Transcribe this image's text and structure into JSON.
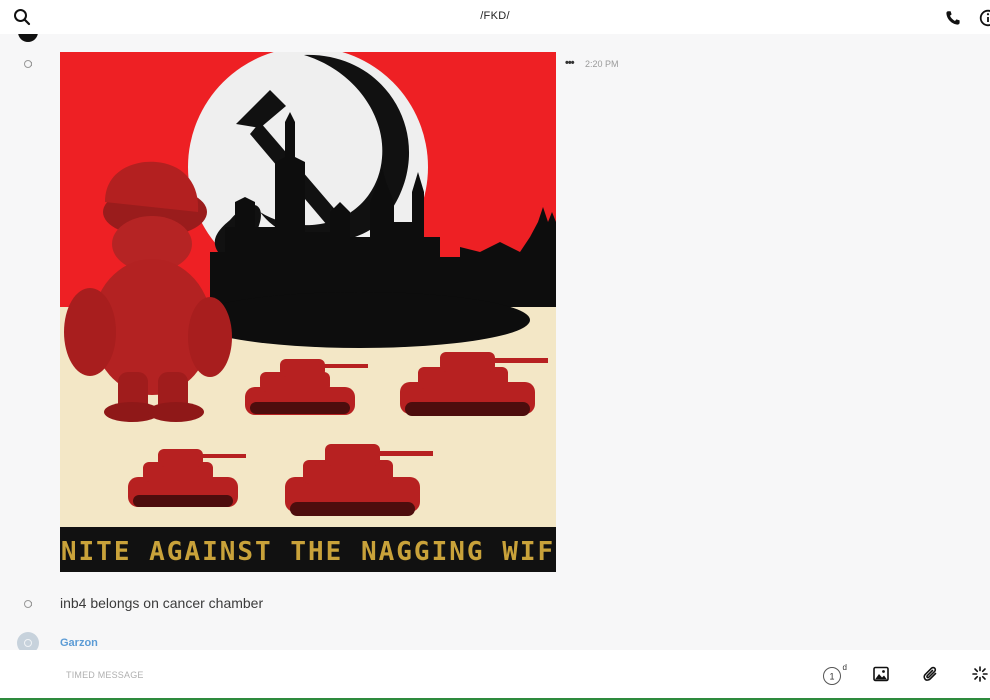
{
  "header": {
    "title": "/FKD/",
    "icons": {
      "search": "search-icon",
      "phone": "phone-icon",
      "info": "info-icon"
    }
  },
  "messages": [
    {
      "type": "image",
      "time": "2:20 PM",
      "poster_caption": "UNITE AGAINST THE NAGGING WIFE"
    },
    {
      "type": "text",
      "text": "inb4 belongs on cancer chamber"
    }
  ],
  "next_sender": {
    "name": "Garzon"
  },
  "composer": {
    "placeholder": "TIMED MESSAGE",
    "timer_value": "1",
    "timer_unit": "d"
  },
  "colors": {
    "poster_red": "#ee2024",
    "poster_cream": "#f3e7c6",
    "sender_name": "#5b9bd5",
    "accent_green": "#2e8b3e"
  }
}
